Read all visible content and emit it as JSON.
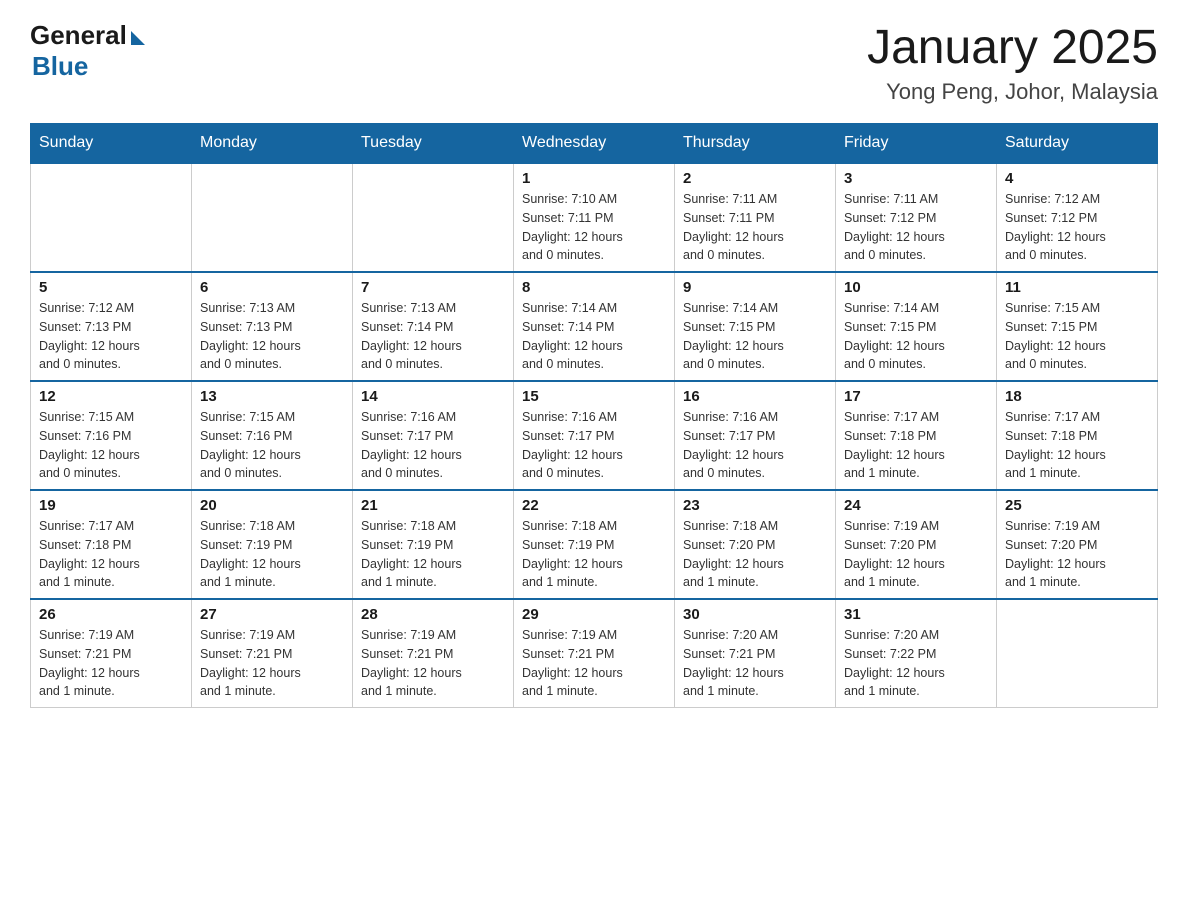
{
  "header": {
    "logo_general": "General",
    "logo_blue": "Blue",
    "month_title": "January 2025",
    "location": "Yong Peng, Johor, Malaysia"
  },
  "calendar": {
    "days_of_week": [
      "Sunday",
      "Monday",
      "Tuesday",
      "Wednesday",
      "Thursday",
      "Friday",
      "Saturday"
    ],
    "weeks": [
      [
        {
          "day": "",
          "info": ""
        },
        {
          "day": "",
          "info": ""
        },
        {
          "day": "",
          "info": ""
        },
        {
          "day": "1",
          "info": "Sunrise: 7:10 AM\nSunset: 7:11 PM\nDaylight: 12 hours\nand 0 minutes."
        },
        {
          "day": "2",
          "info": "Sunrise: 7:11 AM\nSunset: 7:11 PM\nDaylight: 12 hours\nand 0 minutes."
        },
        {
          "day": "3",
          "info": "Sunrise: 7:11 AM\nSunset: 7:12 PM\nDaylight: 12 hours\nand 0 minutes."
        },
        {
          "day": "4",
          "info": "Sunrise: 7:12 AM\nSunset: 7:12 PM\nDaylight: 12 hours\nand 0 minutes."
        }
      ],
      [
        {
          "day": "5",
          "info": "Sunrise: 7:12 AM\nSunset: 7:13 PM\nDaylight: 12 hours\nand 0 minutes."
        },
        {
          "day": "6",
          "info": "Sunrise: 7:13 AM\nSunset: 7:13 PM\nDaylight: 12 hours\nand 0 minutes."
        },
        {
          "day": "7",
          "info": "Sunrise: 7:13 AM\nSunset: 7:14 PM\nDaylight: 12 hours\nand 0 minutes."
        },
        {
          "day": "8",
          "info": "Sunrise: 7:14 AM\nSunset: 7:14 PM\nDaylight: 12 hours\nand 0 minutes."
        },
        {
          "day": "9",
          "info": "Sunrise: 7:14 AM\nSunset: 7:15 PM\nDaylight: 12 hours\nand 0 minutes."
        },
        {
          "day": "10",
          "info": "Sunrise: 7:14 AM\nSunset: 7:15 PM\nDaylight: 12 hours\nand 0 minutes."
        },
        {
          "day": "11",
          "info": "Sunrise: 7:15 AM\nSunset: 7:15 PM\nDaylight: 12 hours\nand 0 minutes."
        }
      ],
      [
        {
          "day": "12",
          "info": "Sunrise: 7:15 AM\nSunset: 7:16 PM\nDaylight: 12 hours\nand 0 minutes."
        },
        {
          "day": "13",
          "info": "Sunrise: 7:15 AM\nSunset: 7:16 PM\nDaylight: 12 hours\nand 0 minutes."
        },
        {
          "day": "14",
          "info": "Sunrise: 7:16 AM\nSunset: 7:17 PM\nDaylight: 12 hours\nand 0 minutes."
        },
        {
          "day": "15",
          "info": "Sunrise: 7:16 AM\nSunset: 7:17 PM\nDaylight: 12 hours\nand 0 minutes."
        },
        {
          "day": "16",
          "info": "Sunrise: 7:16 AM\nSunset: 7:17 PM\nDaylight: 12 hours\nand 0 minutes."
        },
        {
          "day": "17",
          "info": "Sunrise: 7:17 AM\nSunset: 7:18 PM\nDaylight: 12 hours\nand 1 minute."
        },
        {
          "day": "18",
          "info": "Sunrise: 7:17 AM\nSunset: 7:18 PM\nDaylight: 12 hours\nand 1 minute."
        }
      ],
      [
        {
          "day": "19",
          "info": "Sunrise: 7:17 AM\nSunset: 7:18 PM\nDaylight: 12 hours\nand 1 minute."
        },
        {
          "day": "20",
          "info": "Sunrise: 7:18 AM\nSunset: 7:19 PM\nDaylight: 12 hours\nand 1 minute."
        },
        {
          "day": "21",
          "info": "Sunrise: 7:18 AM\nSunset: 7:19 PM\nDaylight: 12 hours\nand 1 minute."
        },
        {
          "day": "22",
          "info": "Sunrise: 7:18 AM\nSunset: 7:19 PM\nDaylight: 12 hours\nand 1 minute."
        },
        {
          "day": "23",
          "info": "Sunrise: 7:18 AM\nSunset: 7:20 PM\nDaylight: 12 hours\nand 1 minute."
        },
        {
          "day": "24",
          "info": "Sunrise: 7:19 AM\nSunset: 7:20 PM\nDaylight: 12 hours\nand 1 minute."
        },
        {
          "day": "25",
          "info": "Sunrise: 7:19 AM\nSunset: 7:20 PM\nDaylight: 12 hours\nand 1 minute."
        }
      ],
      [
        {
          "day": "26",
          "info": "Sunrise: 7:19 AM\nSunset: 7:21 PM\nDaylight: 12 hours\nand 1 minute."
        },
        {
          "day": "27",
          "info": "Sunrise: 7:19 AM\nSunset: 7:21 PM\nDaylight: 12 hours\nand 1 minute."
        },
        {
          "day": "28",
          "info": "Sunrise: 7:19 AM\nSunset: 7:21 PM\nDaylight: 12 hours\nand 1 minute."
        },
        {
          "day": "29",
          "info": "Sunrise: 7:19 AM\nSunset: 7:21 PM\nDaylight: 12 hours\nand 1 minute."
        },
        {
          "day": "30",
          "info": "Sunrise: 7:20 AM\nSunset: 7:21 PM\nDaylight: 12 hours\nand 1 minute."
        },
        {
          "day": "31",
          "info": "Sunrise: 7:20 AM\nSunset: 7:22 PM\nDaylight: 12 hours\nand 1 minute."
        },
        {
          "day": "",
          "info": ""
        }
      ]
    ]
  }
}
